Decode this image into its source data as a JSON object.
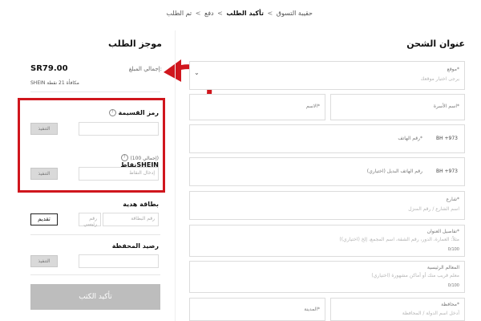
{
  "breadcrumb": {
    "bag": "حقيبة التسوق",
    "confirm": "تأكيد الطلب",
    "payment": "دفع",
    "done": "تم الطلب",
    "sep": ">"
  },
  "summary": {
    "title": "موجز الطلب",
    "total_label": "إجمالي المبلغ:",
    "total_value": "SR79.00",
    "points_text": "SHEIN مكافأة 21 نقطة"
  },
  "coupon": {
    "label": "رمز القسيمة",
    "info": "?",
    "button": "التنفيذ"
  },
  "points": {
    "label": "نقاطSHEIN",
    "total": "(إجمالي 100)",
    "info": "?",
    "placeholder": "إدخال النقاط",
    "button": "التنفيذ"
  },
  "giftcard": {
    "label": "بطاقة هدية",
    "card_placeholder": "رقم البطاقة",
    "pin_placeholder": "رقم رئيسي",
    "button": "تقديم"
  },
  "wallet": {
    "label": "رصيد المحفظة",
    "button": "التنفيذ"
  },
  "confirm_button": "تأكيد الكتب",
  "shipping": {
    "title": "عنوان الشحن",
    "location_label": "موقع*",
    "location_placeholder": "يرجى اختيار موقعك",
    "last_name_label": "اسم الأسرة*",
    "first_name_label": "الاسم*",
    "phone_label": "رقم الهاتف*",
    "phone_code": "BH +973",
    "alt_phone_label": "رقم الهاتف البديل (اختياري)",
    "alt_phone_code": "BH +973",
    "street_label": "شارع*",
    "street_placeholder": "اسم الشارع / رقم المنزل",
    "address_details_label": "تفاصيل العنوان*",
    "address_details_placeholder": "(مثلاً: العمارة، الدور، رقم الشقة، اسم المجمع، إلخ (اختياري)",
    "address_details_count": "0/100",
    "landmark_label": "المعالم الرئيسية",
    "landmark_placeholder": "معلم قريب منك أو أماكن مشهورة (اختياري)",
    "landmark_count": "0/100",
    "governorate_label": "محافظة*",
    "governorate_placeholder": "أدخل اسم الدولة / المحافظة",
    "city_label": "المدينة*"
  },
  "colors": {
    "highlight": "#d0161d",
    "disabled_button": "#d9d9d9"
  }
}
